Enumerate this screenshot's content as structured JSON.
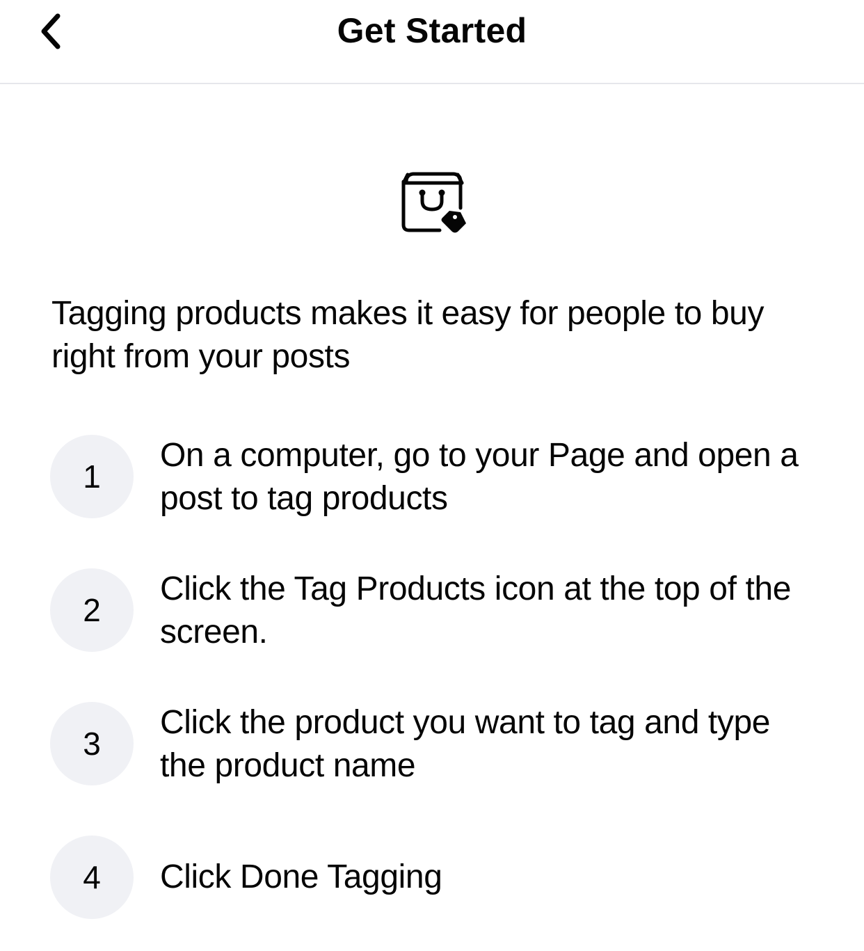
{
  "header": {
    "title": "Get Started",
    "back_icon": "chevron-left-icon"
  },
  "hero": {
    "icon": "shopping-bag-tag-icon"
  },
  "intro": {
    "text": "Tagging products makes it easy for people to buy right from your posts"
  },
  "steps": [
    {
      "number": "1",
      "text": "On a computer, go to your Page and open a post to tag products"
    },
    {
      "number": "2",
      "text": "Click the Tag Products icon at the top of the screen."
    },
    {
      "number": "3",
      "text": "Click the product you want to tag and type the product name"
    },
    {
      "number": "4",
      "text": "Click Done Tagging"
    }
  ],
  "colors": {
    "text": "#050505",
    "step_circle_bg": "#f0f1f5",
    "divider": "#e6e7eb"
  }
}
